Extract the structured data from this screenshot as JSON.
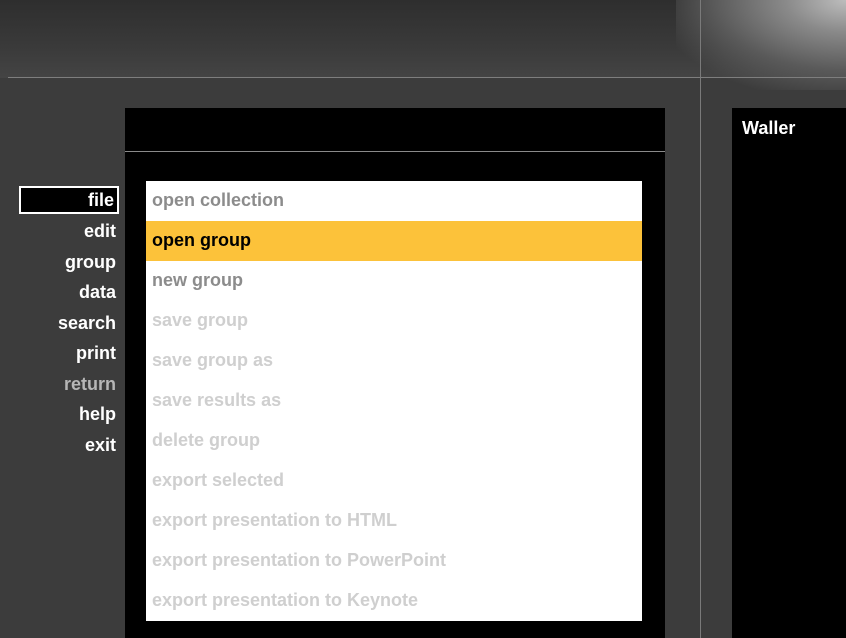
{
  "right_panel": {
    "title": "Waller"
  },
  "left_menu": [
    {
      "label": "file",
      "state": "selected"
    },
    {
      "label": "edit",
      "state": "normal"
    },
    {
      "label": "group",
      "state": "normal"
    },
    {
      "label": "data",
      "state": "normal"
    },
    {
      "label": "search",
      "state": "normal"
    },
    {
      "label": "print",
      "state": "normal"
    },
    {
      "label": "return",
      "state": "dim"
    },
    {
      "label": "help",
      "state": "normal"
    },
    {
      "label": "exit",
      "state": "normal"
    }
  ],
  "file_menu": [
    {
      "label": "open collection",
      "state": "enabled"
    },
    {
      "label": "open group",
      "state": "active"
    },
    {
      "label": "new group",
      "state": "enabled"
    },
    {
      "label": "save group",
      "state": "disabled"
    },
    {
      "label": "save group as",
      "state": "disabled"
    },
    {
      "label": "save results as",
      "state": "disabled"
    },
    {
      "label": "delete group",
      "state": "disabled"
    },
    {
      "label": "export selected",
      "state": "disabled"
    },
    {
      "label": "export presentation to HTML",
      "state": "disabled"
    },
    {
      "label": "export presentation to PowerPoint",
      "state": "disabled"
    },
    {
      "label": "export presentation to Keynote",
      "state": "disabled"
    }
  ],
  "colors": {
    "highlight": "#fcc23a",
    "background": "#3c3c3c"
  }
}
